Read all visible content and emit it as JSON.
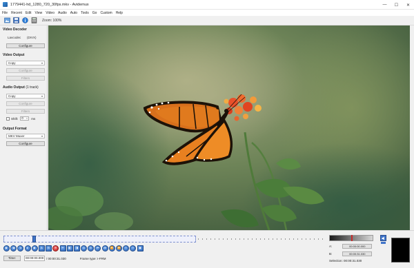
{
  "window": {
    "title": "1779441-hd_1280_720_30fps.mkv - Avidemux",
    "minimize": "—",
    "maximize": "☐",
    "close": "✕"
  },
  "menu": [
    "File",
    "Recent",
    "Edit",
    "View",
    "Video",
    "Audio",
    "Auto",
    "Tools",
    "Go",
    "Custom",
    "Help"
  ],
  "toolbar": {
    "icons": [
      "open-video-icon",
      "save-video-icon",
      "info-icon",
      "calculator-icon"
    ],
    "zoom": "Zoom: 100%"
  },
  "video_decoder": {
    "title": "Video Decoder",
    "decoder_label": "Lavcodec",
    "decoder_value": "(DIVX)",
    "configure": "Configure"
  },
  "video_output": {
    "title": "Video Output",
    "codec": "Copy",
    "configure": "Configure",
    "filters": "Filters"
  },
  "audio_output": {
    "title": "Audio Output",
    "tracks": "(1 track)",
    "codec": "Copy",
    "configure": "Configure",
    "filters": "Filters",
    "shift_label": "Shift:",
    "shift_value": "0",
    "shift_unit": "ms"
  },
  "output_format": {
    "title": "Output Format",
    "format": "MKV Muxer",
    "configure": "Configure"
  },
  "timeline": {
    "position_fraction": 0.09,
    "selection_end_fraction": 0.6
  },
  "controls": {
    "icons": [
      "play-icon",
      "rewind-icon",
      "previous-frame-icon",
      "next-frame-icon",
      "fast-forward-icon",
      "set-marker-a-icon",
      "set-marker-b-icon",
      "delete-icon",
      "cut-icon",
      "previous-black-frame-icon",
      "next-black-frame-icon",
      "goto-marker-a-icon",
      "goto-marker-b-icon",
      "previous-keyframe-icon",
      "next-keyframe-icon",
      "first-frame-icon",
      "last-frame-icon",
      "previous-cut-icon",
      "next-cut-icon",
      "play-filtered-icon"
    ]
  },
  "time": {
    "button": "Time:",
    "current": "00:00:00.000",
    "total": "/ 00:00:31.030",
    "frame_type": "Frame type:  I-FRM"
  },
  "markers": {
    "a_label": "A:",
    "a_value": "00:00:00.000",
    "b_label": "B:",
    "b_value": "00:00:31.030",
    "selection": "Selection: 00:00:31.030"
  },
  "colors": {
    "accent": "#3f74c9",
    "selection_border": "#7d8fcf",
    "delete": "#c42424"
  }
}
